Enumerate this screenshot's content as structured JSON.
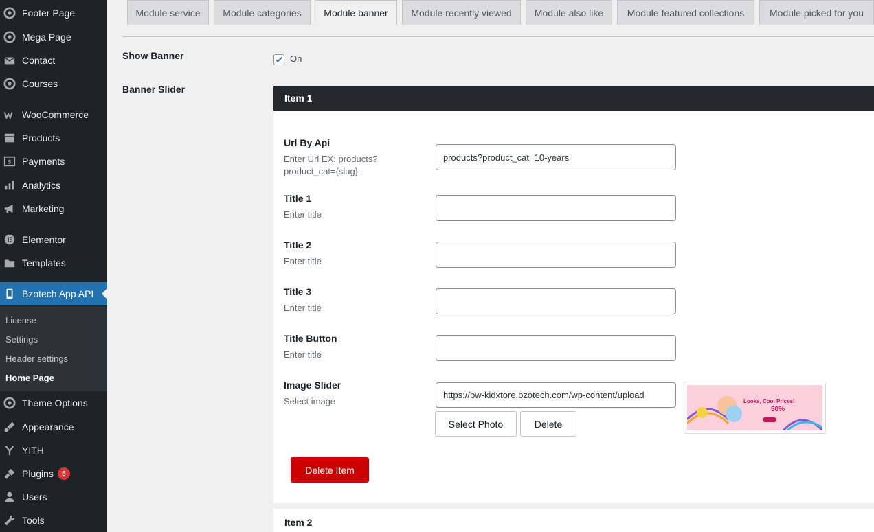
{
  "sidebar": {
    "items": [
      {
        "label": "Footer Page",
        "icon": "gear-icon"
      },
      {
        "label": "Mega Page",
        "icon": "gear-icon"
      },
      {
        "label": "Contact",
        "icon": "mail-icon"
      },
      {
        "label": "Courses",
        "icon": "gear-icon"
      },
      {
        "label": "WooCommerce",
        "icon": "woocommerce-icon"
      },
      {
        "label": "Products",
        "icon": "archive-icon"
      },
      {
        "label": "Payments",
        "icon": "dollar-icon"
      },
      {
        "label": "Analytics",
        "icon": "bar-chart-icon"
      },
      {
        "label": "Marketing",
        "icon": "megaphone-icon"
      },
      {
        "label": "Elementor",
        "icon": "elementor-icon"
      },
      {
        "label": "Templates",
        "icon": "folder-icon"
      },
      {
        "label": "Bzotech App API",
        "icon": "smartphone-icon"
      },
      {
        "label": "Theme Options",
        "icon": "gear-icon"
      },
      {
        "label": "Appearance",
        "icon": "paintbrush-icon"
      },
      {
        "label": "YITH",
        "icon": "yith-icon"
      },
      {
        "label": "Plugins",
        "icon": "plugin-icon",
        "badge": "5"
      },
      {
        "label": "Users",
        "icon": "user-icon"
      },
      {
        "label": "Tools",
        "icon": "wrench-icon"
      }
    ],
    "submenu": [
      "License",
      "Settings",
      "Header settings",
      "Home Page"
    ]
  },
  "tabs": [
    "Module service",
    "Module categories",
    "Module banner",
    "Module recently viewed",
    "Module also like",
    "Module featured collections",
    "Module picked for you"
  ],
  "show_banner": {
    "label": "Show Banner",
    "checkbox_label": "On",
    "checked": true
  },
  "banner_slider": {
    "label": "Banner Slider"
  },
  "item1": {
    "header": "Item 1",
    "url_by_api": {
      "label": "Url By Api",
      "desc": "Enter Url EX: products?product_cat={slug}",
      "value": "products?product_cat=10-years"
    },
    "title1": {
      "label": "Title 1",
      "desc": "Enter title",
      "value": ""
    },
    "title2": {
      "label": "Title 2",
      "desc": "Enter title",
      "value": ""
    },
    "title3": {
      "label": "Title 3",
      "desc": "Enter title",
      "value": ""
    },
    "title_button": {
      "label": "Title Button",
      "desc": "Enter title",
      "value": ""
    },
    "image_slider": {
      "label": "Image Slider",
      "desc": "Select image",
      "value": "https://bw-kidxtore.bzotech.com/wp-content/upload",
      "select_label": "Select Photo",
      "delete_label": "Delete",
      "thumb_headline": "Looks, Cool Prices!",
      "thumb_percent": "50%"
    },
    "delete_item_label": "Delete Item"
  },
  "item2": {
    "header": "Item 2"
  },
  "colors": {
    "sidebar_bg": "#1d2327",
    "active_menu": "#2271b1",
    "delete_red": "#cc0000",
    "badge_red": "#d63638"
  }
}
